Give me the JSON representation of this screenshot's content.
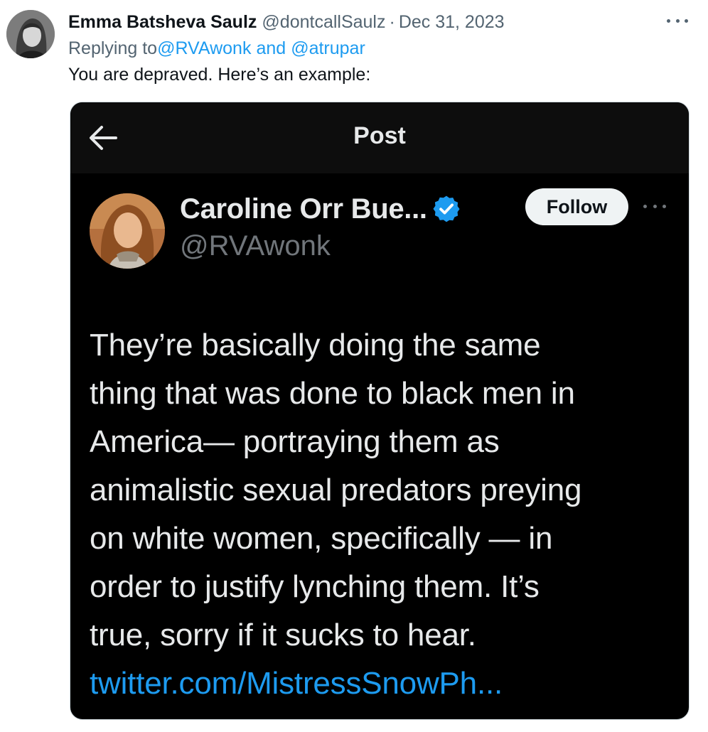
{
  "tweet": {
    "author_name": "Emma Batsheva Saulz",
    "author_handle": "@dontcallSaulz",
    "separator": "·",
    "date": "Dec 31, 2023",
    "more_label": "···",
    "reply_prefix": "Replying to",
    "reply_mention_1": "@RVAwonk",
    "reply_and": "and",
    "reply_mention_2": "@atrupar",
    "text": "You are depraved. Here’s an example:"
  },
  "embed": {
    "title": "Post",
    "author_name": "Caroline Orr Bue...",
    "author_handle": "@RVAwonk",
    "follow_label": "Follow",
    "more_label": "···",
    "body_lines": [
      "They’re basically doing the same",
      "thing that was done to black men in",
      "America— portraying them as",
      "animalistic sexual predators preying",
      "on white women, specifically — in",
      "order to justify lynching them. It’s",
      "true, sorry if it sucks to hear."
    ],
    "link": "twitter.com/MistressSnowPh..."
  },
  "colors": {
    "accent": "#1d9bf0",
    "muted": "#536471",
    "embed_bg": "#000000",
    "embed_text": "#e7e9ea"
  },
  "icons": {
    "tweet_more": "more-horizontal-icon",
    "back": "arrow-left-icon",
    "verified": "verified-badge-icon",
    "embed_more": "more-horizontal-icon"
  }
}
